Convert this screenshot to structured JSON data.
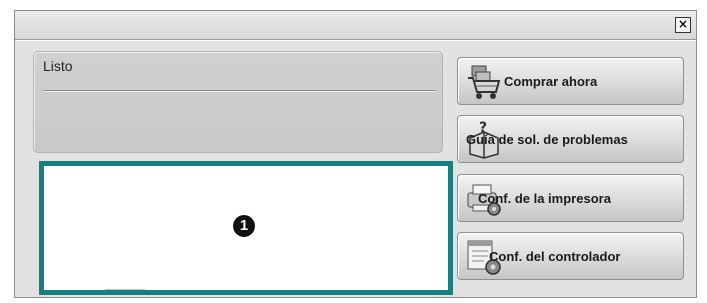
{
  "window": {
    "close_symbol": "×"
  },
  "status": {
    "text": "Listo"
  },
  "callout": {
    "number": "1"
  },
  "buttons": {
    "buy": {
      "label": "Comprar ahora",
      "icon": "shopping-cart-icon"
    },
    "guide": {
      "label": "Guía de sol. de problemas",
      "icon": "help-book-icon"
    },
    "printer": {
      "label": "Conf. de la impresora",
      "icon": "printer-settings-icon"
    },
    "driver": {
      "label": "Conf. del controlador",
      "icon": "driver-settings-icon"
    }
  },
  "colors": {
    "highlight_border": "#168080",
    "window_bg": "#e2e2e2"
  }
}
